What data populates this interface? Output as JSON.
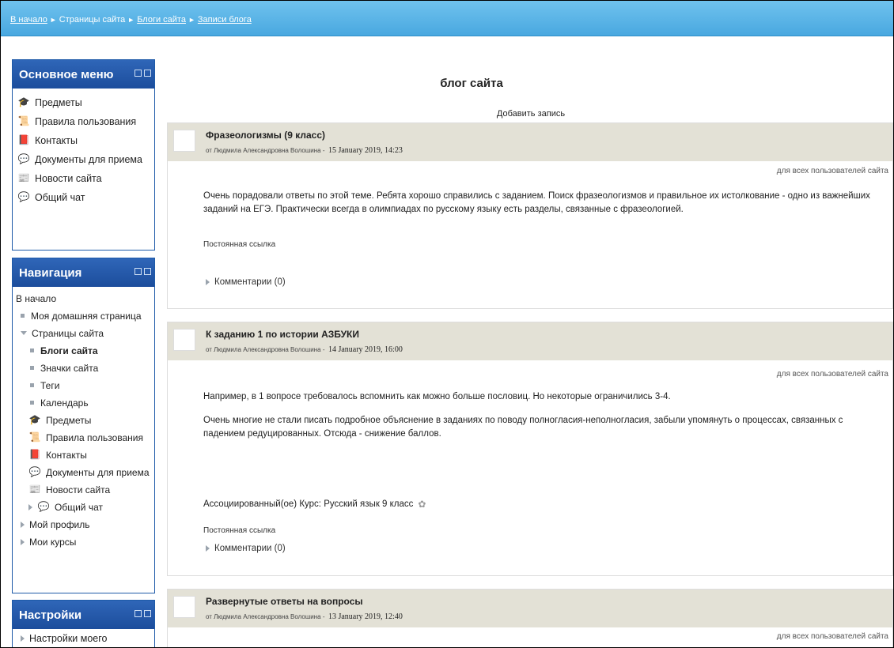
{
  "breadcrumb": {
    "home": "В начало",
    "site_pages": "Страницы сайта",
    "site_blogs": "Блоги сайта",
    "blog_entries": "Записи блога"
  },
  "main_menu": {
    "title": "Основное меню",
    "items": [
      {
        "label": "Предметы",
        "icon": "hat-icon"
      },
      {
        "label": "Правила пользования",
        "icon": "rules-icon"
      },
      {
        "label": "Контакты",
        "icon": "contacts-icon"
      },
      {
        "label": "Документы для приема",
        "icon": "documents-icon"
      },
      {
        "label": "Новости сайта",
        "icon": "news-icon"
      },
      {
        "label": "Общий чат",
        "icon": "chat-icon"
      }
    ]
  },
  "navigation": {
    "title": "Навигация",
    "home": "В начало",
    "my_home": "Моя домашняя страница",
    "site_pages": "Страницы сайта",
    "site_blogs": "Блоги сайта",
    "site_badges": "Значки сайта",
    "tags": "Теги",
    "calendar": "Календарь",
    "subjects": "Предметы",
    "rules": "Правила пользования",
    "contacts": "Контакты",
    "documents": "Документы для приема",
    "news": "Новости сайта",
    "chat": "Общий чат",
    "my_profile": "Мой профиль",
    "my_courses": "Мои курсы"
  },
  "settings": {
    "title": "Настройки",
    "item": "Настройки моего"
  },
  "main": {
    "title": "блог сайта",
    "add_entry": "Добавить запись"
  },
  "posts": [
    {
      "title": "Фразеологизмы (9 класс)",
      "author": "от Людмила Александровна Волошина -",
      "date": "15 January 2019, 14:23",
      "visibility": "для всех пользователей сайта",
      "paragraphs": [
        "Очень порадовали ответы по этой теме. Ребята хорошо справились с заданием. Поиск фразеологизмов и правильное их истолкование - одно из важнейших заданий на ЕГЭ. Практически всегда в олимпиадах по русскому языку есть разделы, связанные с фразеологией."
      ],
      "permalink": "Постоянная ссылка",
      "comments": "Комментарии (0)"
    },
    {
      "title": "К заданию 1 по истории АЗБУКИ",
      "author": "от Людмила Александровна Волошина -",
      "date": "14 January 2019, 16:00",
      "visibility": "для всех пользователей сайта",
      "paragraphs": [
        "Например, в 1 вопросе требовалось вспомнить как можно больше пословиц. Но некоторые ограничились 3-4.",
        "Очень многие не стали писать подробное объяснение в заданиях по поводу полногласия-неполногласия, забыли упомянуть о процессах, связанных с падением редуцированных. Отсюда - снижение баллов."
      ],
      "course": "Ассоциированный(ое) Курс: Русский язык 9 класс",
      "permalink": "Постоянная ссылка",
      "comments": "Комментарии (0)"
    },
    {
      "title": "Развернутые ответы на вопросы",
      "author": "от Людмила Александровна Волошина -",
      "date": "13 January 2019, 12:40",
      "visibility": "для всех пользователей сайта"
    }
  ]
}
